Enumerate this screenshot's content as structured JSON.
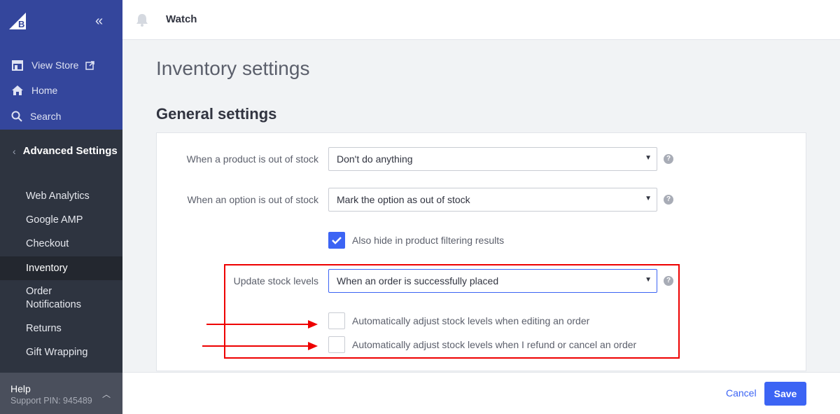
{
  "sidebar": {
    "top_links": [
      {
        "label": "View Store",
        "icon": "storefront-icon"
      },
      {
        "label": "Home",
        "icon": "home-icon"
      },
      {
        "label": "Search",
        "icon": "search-icon"
      }
    ],
    "section_title": "Advanced Settings",
    "items": [
      {
        "label": "Web Analytics"
      },
      {
        "label": "Google AMP"
      },
      {
        "label": "Checkout"
      },
      {
        "label": "Inventory",
        "active": true
      },
      {
        "label": "Order Notifications"
      },
      {
        "label": "Returns"
      },
      {
        "label": "Gift Wrapping"
      }
    ],
    "help": {
      "label": "Help",
      "pin": "Support PIN: 945489"
    }
  },
  "topbar": {
    "title": "Watch"
  },
  "page": {
    "title": "Inventory settings",
    "section_title": "General settings"
  },
  "form": {
    "out_of_stock_label": "When a product is out of stock",
    "out_of_stock_value": "Don't do anything",
    "option_out_of_stock_label": "When an option is out of stock",
    "option_out_of_stock_value": "Mark the option as out of stock",
    "hide_filter_label": "Also hide in product filtering results",
    "update_stock_label": "Update stock levels",
    "update_stock_value": "When an order is successfully placed",
    "adjust_edit_label": "Automatically adjust stock levels when editing an order",
    "adjust_refund_label": "Automatically adjust stock levels when I refund or cancel an order",
    "help_glyph": "?"
  },
  "footer": {
    "cancel": "Cancel",
    "save": "Save"
  },
  "colors": {
    "primary": "#3c64f4",
    "sidebar_top": "#34469c",
    "sidebar": "#2e3440",
    "annotation": "#ee0000"
  }
}
